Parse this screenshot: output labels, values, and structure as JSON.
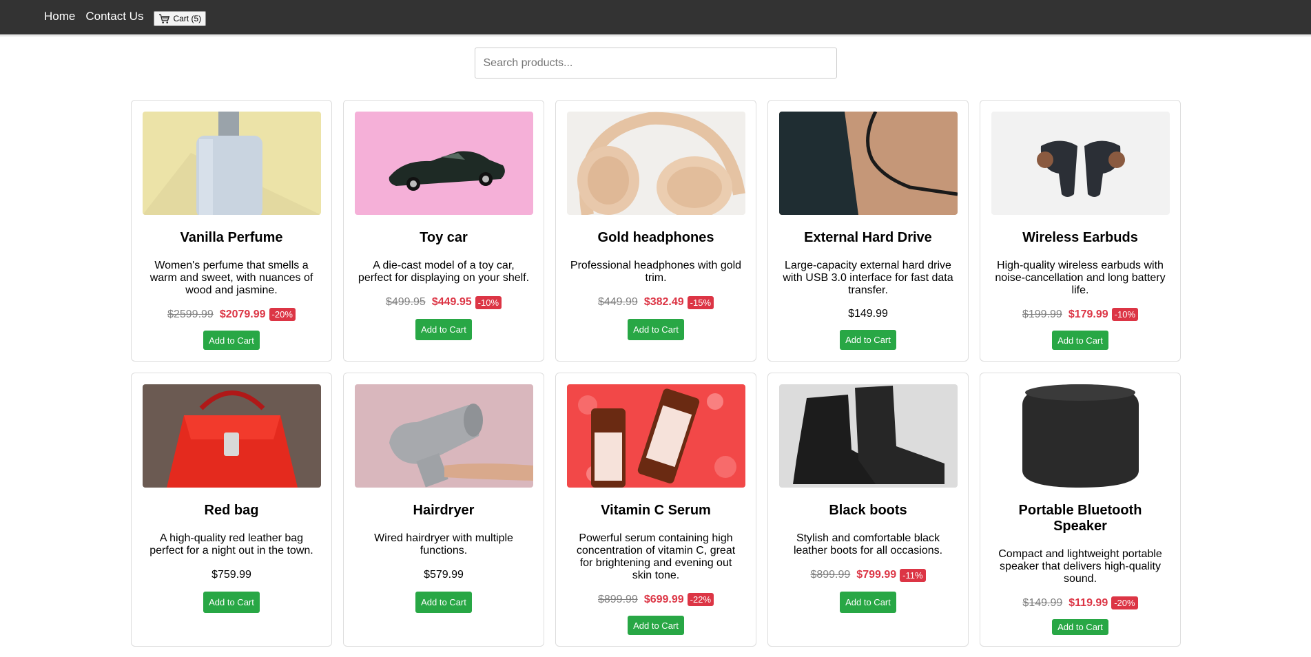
{
  "nav": {
    "home": "Home",
    "contact": "Contact Us",
    "cart_label": "Cart (5)"
  },
  "search": {
    "placeholder": "Search products..."
  },
  "colors": {
    "navbar": "#333333",
    "accent_green": "#28a745",
    "sale_red": "#dc3545"
  },
  "products": [
    {
      "name": "Vanilla Perfume",
      "desc": "Women's perfume that smells a warm and sweet, with nuances of wood and jasmine.",
      "old_price": "$2599.99",
      "price": "$2079.99",
      "discount": "-20%",
      "button": "Add to Cart",
      "image": "perfume-bottle-image"
    },
    {
      "name": "Toy car",
      "desc": "A die-cast model of a toy car, perfect for displaying on your shelf.",
      "old_price": "$499.95",
      "price": "$449.95",
      "discount": "-10%",
      "button": "Add to Cart",
      "image": "toy-car-image"
    },
    {
      "name": "Gold headphones",
      "desc": "Professional headphones with gold trim.",
      "old_price": "$449.99",
      "price": "$382.49",
      "discount": "-15%",
      "button": "Add to Cart",
      "image": "headphones-image"
    },
    {
      "name": "External Hard Drive",
      "desc": "Large-capacity external hard drive with USB 3.0 interface for fast data transfer.",
      "price": "$149.99",
      "button": "Add to Cart",
      "image": "hard-drive-image"
    },
    {
      "name": "Wireless Earbuds",
      "desc": "High-quality wireless earbuds with noise-cancellation and long battery life.",
      "old_price": "$199.99",
      "price": "$179.99",
      "discount": "-10%",
      "button": "Add to Cart",
      "image": "earbuds-image"
    },
    {
      "name": "Red bag",
      "desc": "A high-quality red leather bag perfect for a night out in the town.",
      "price": "$759.99",
      "button": "Add to Cart",
      "image": "red-bag-image"
    },
    {
      "name": "Hairdryer",
      "desc": "Wired hairdryer with multiple functions.",
      "price": "$579.99",
      "button": "Add to Cart",
      "image": "hairdryer-image"
    },
    {
      "name": "Vitamin C Serum",
      "desc": "Powerful serum containing high concentration of vitamin C, great for brightening and evening out skin tone.",
      "old_price": "$899.99",
      "price": "$699.99",
      "discount": "-22%",
      "button": "Add to Cart",
      "image": "serum-bottles-image"
    },
    {
      "name": "Black boots",
      "desc": "Stylish and comfortable black leather boots for all occasions.",
      "old_price": "$899.99",
      "price": "$799.99",
      "discount": "-11%",
      "button": "Add to Cart",
      "image": "boots-image"
    },
    {
      "name": "Portable Bluetooth Speaker",
      "desc": "Compact and lightweight portable speaker that delivers high-quality sound.",
      "old_price": "$149.99",
      "price": "$119.99",
      "discount": "-20%",
      "button": "Add to Cart",
      "image": "speaker-image"
    }
  ]
}
